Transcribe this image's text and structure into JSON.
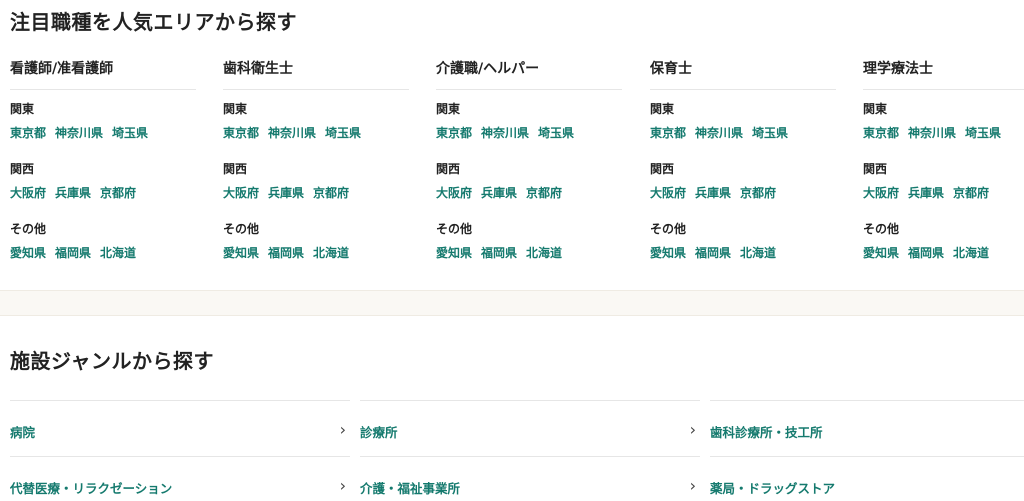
{
  "section1_title": "注目職種を人気エリアから探す",
  "section2_title": "施設ジャンルから探す",
  "region_labels": {
    "kanto": "関東",
    "kansai": "関西",
    "other": "その他"
  },
  "region_links": {
    "kanto": [
      "東京都",
      "神奈川県",
      "埼玉県"
    ],
    "kansai": [
      "大阪府",
      "兵庫県",
      "京都府"
    ],
    "other": [
      "愛知県",
      "福岡県",
      "北海道"
    ]
  },
  "jobs": [
    "看護師/准看護師",
    "歯科衛生士",
    "介護職/ヘルパー",
    "保育士",
    "理学療法士"
  ],
  "genres": {
    "row1": [
      "病院",
      "診療所",
      "歯科診療所・技工所"
    ],
    "row2": [
      "代替医療・リラクゼーション",
      "介護・福祉事業所",
      "薬局・ドラッグストア"
    ]
  },
  "chevron": "›",
  "colors": {
    "link": "#157a6e",
    "text": "#222222",
    "band": "#faf8f4"
  }
}
